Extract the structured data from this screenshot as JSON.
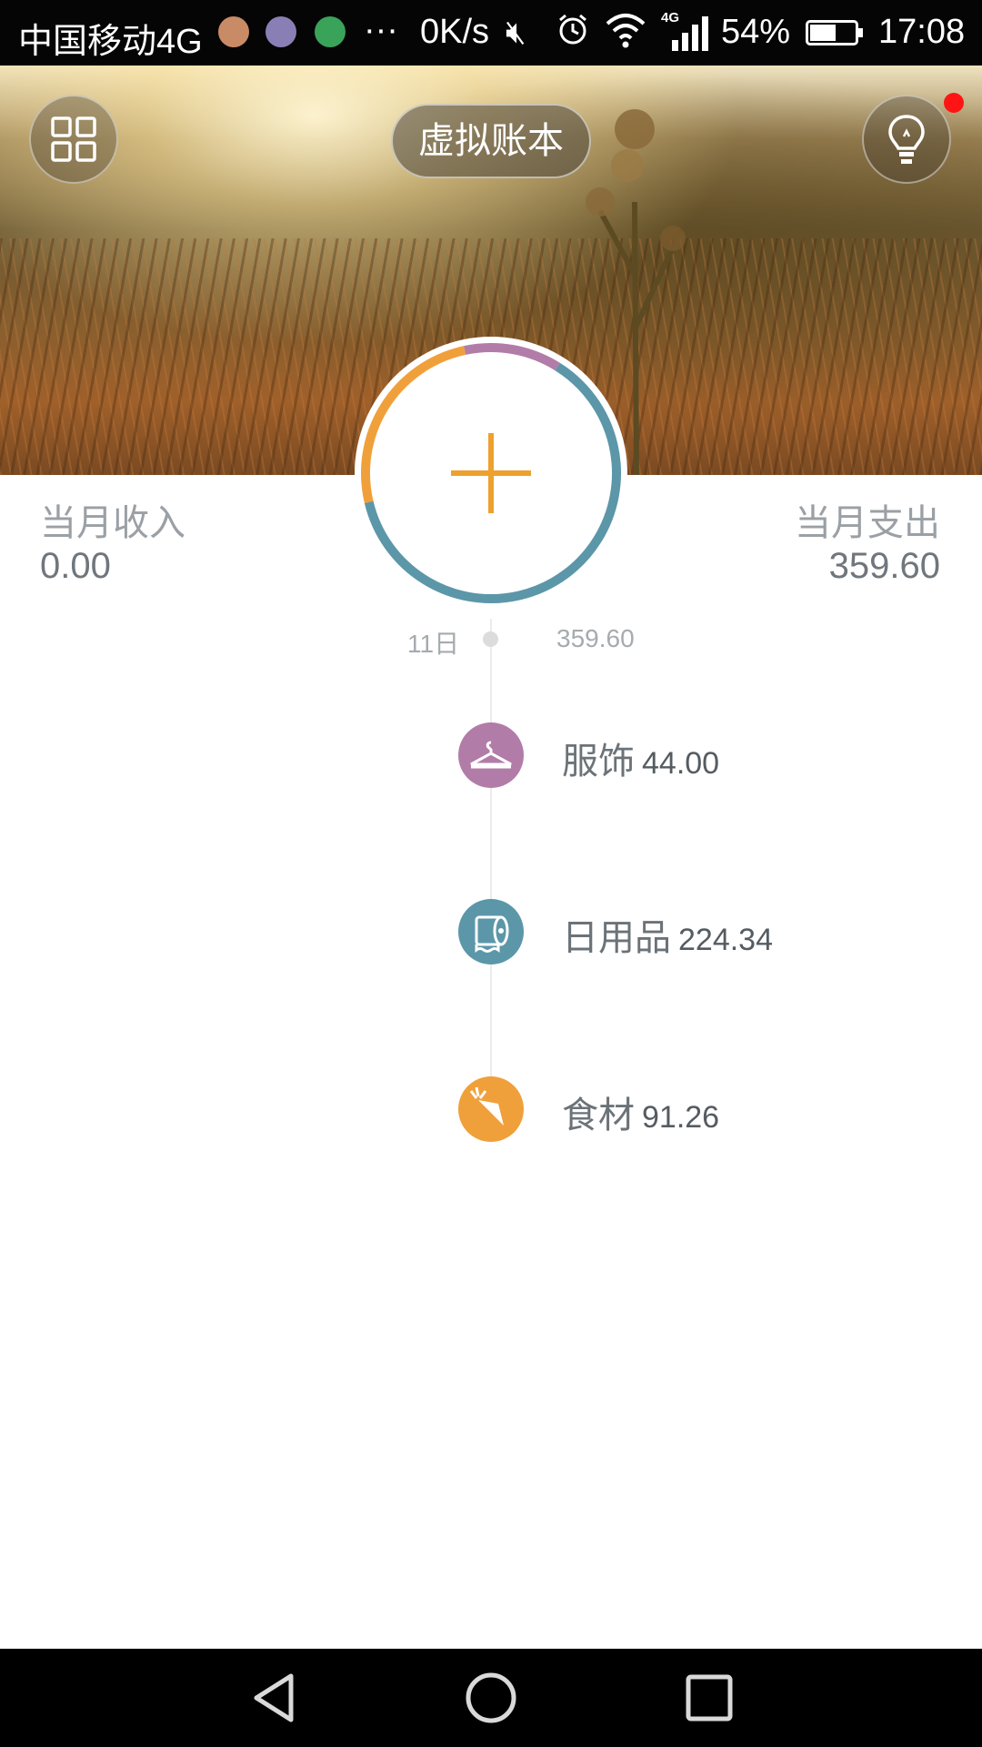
{
  "status_bar": {
    "carrier": "中国移动4G",
    "network_speed": "0K/s",
    "network_type": "4G",
    "battery": "54%",
    "time": "17:08"
  },
  "header": {
    "book_name": "虚拟账本"
  },
  "summary": {
    "income_label": "当月收入",
    "income_value": "0.00",
    "expense_label": "当月支出",
    "expense_value": "359.60"
  },
  "ring": {
    "segments": [
      {
        "category": "日用品",
        "amount": 224.34,
        "color": "#5b97a8"
      },
      {
        "category": "食材",
        "amount": 91.26,
        "color": "#f0a03a"
      },
      {
        "category": "服饰",
        "amount": 44.0,
        "color": "#b27ca8"
      }
    ],
    "add_color": "#eea12e"
  },
  "timeline": {
    "day": "11日",
    "day_total": "359.60",
    "entries": [
      {
        "name": "服饰",
        "amount": "44.00",
        "icon": "hanger-icon",
        "color": "#b27ca8"
      },
      {
        "name": "日用品",
        "amount": "224.34",
        "icon": "tissue-roll-icon",
        "color": "#5b97a8"
      },
      {
        "name": "食材",
        "amount": "91.26",
        "icon": "carrot-icon",
        "color": "#f0a03a"
      }
    ]
  },
  "nav": {
    "icons": [
      "back-icon",
      "home-icon",
      "recents-icon"
    ]
  }
}
